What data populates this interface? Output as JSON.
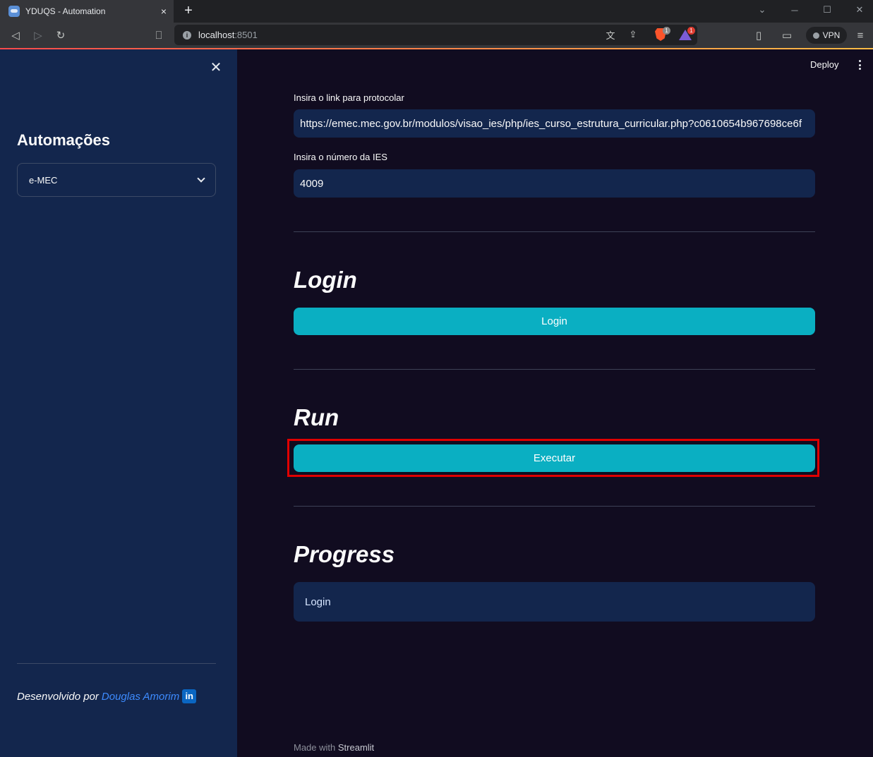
{
  "browser": {
    "tab_title": "YDUQS - Automation",
    "tab_close": "×",
    "new_tab": "+",
    "url_host": "localhost",
    "url_port": ":8501",
    "shield_badge": "1",
    "rewards_badge": "1",
    "vpn_label": "VPN"
  },
  "sidebar": {
    "title": "Automações",
    "select_value": "e-MEC",
    "credit_prefix": "Desenvolvido por",
    "credit_author": "Douglas Amorim",
    "linkedin_text": "in"
  },
  "header": {
    "deploy_label": "Deploy"
  },
  "form": {
    "link_label": "Insira o link para protocolar",
    "link_value": "https://emec.mec.gov.br/modulos/visao_ies/php/ies_curso_estrutura_curricular.php?c0610654b967698ce6f",
    "ies_label": "Insira o número da IES",
    "ies_value": "4009"
  },
  "sections": {
    "login_heading": "Login",
    "login_button": "Login",
    "run_heading": "Run",
    "run_button": "Executar",
    "progress_heading": "Progress",
    "progress_status": "Login"
  },
  "footer": {
    "made_with": "Made with",
    "brand": "Streamlit"
  },
  "colors": {
    "sidebar_bg": "#13264d",
    "main_bg": "#110c20",
    "primary_button": "#0aafc2",
    "highlight_border": "#e00000",
    "link": "#3d8bff"
  }
}
